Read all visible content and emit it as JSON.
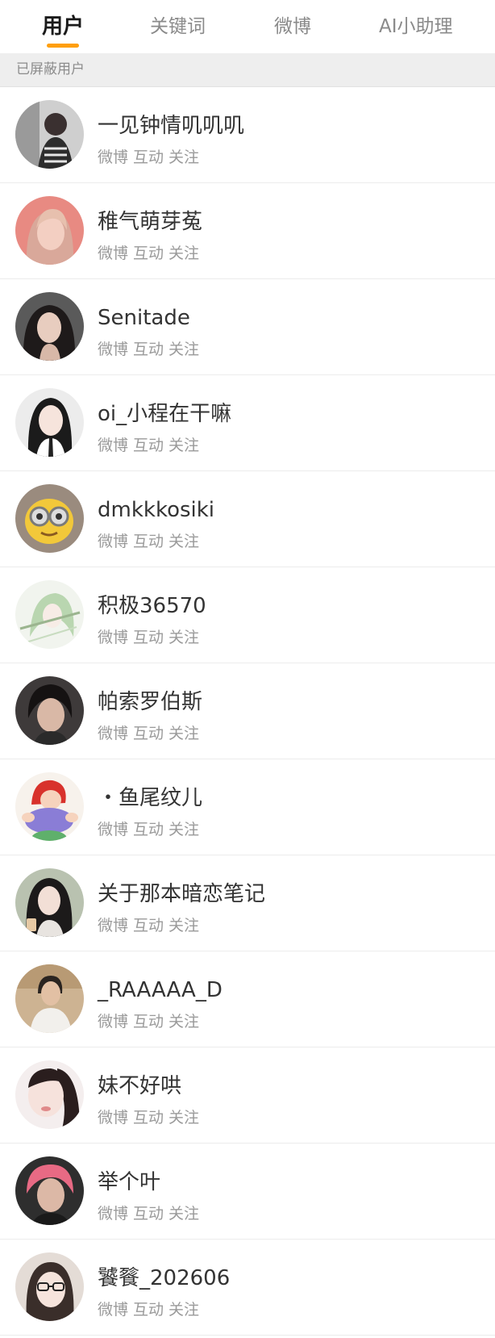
{
  "tabs": [
    {
      "label": "用户",
      "active": true
    },
    {
      "label": "关键词",
      "active": false
    },
    {
      "label": "微博",
      "active": false
    },
    {
      "label": "AI小助理",
      "active": false
    }
  ],
  "accent_color": "#ff9f0a",
  "section_header": "已屏蔽用户",
  "meta_labels": {
    "weibo": "微博",
    "interact": "互动",
    "follow": "关注"
  },
  "users": [
    {
      "name": "一见钟情叽叽叽",
      "avatar": "photo-avatar"
    },
    {
      "name": "稚气萌芽菟",
      "avatar": "photo-avatar"
    },
    {
      "name": "Senitade",
      "avatar": "photo-avatar"
    },
    {
      "name": "oi_小程在干嘛",
      "avatar": "photo-avatar"
    },
    {
      "name": "dmkkkosiki",
      "avatar": "cartoon-avatar"
    },
    {
      "name": "积极36570",
      "avatar": "illustration-avatar"
    },
    {
      "name": "帕索罗伯斯",
      "avatar": "photo-avatar"
    },
    {
      "name": "・鱼尾纹儿",
      "avatar": "cartoon-avatar"
    },
    {
      "name": "关于那本暗恋笔记",
      "avatar": "photo-avatar"
    },
    {
      "name": "_RAAAAA_D",
      "avatar": "photo-avatar"
    },
    {
      "name": "妹不好哄",
      "avatar": "photo-avatar"
    },
    {
      "name": "举个叶",
      "avatar": "photo-avatar"
    },
    {
      "name": "饕餮_202606",
      "avatar": "photo-avatar"
    }
  ]
}
